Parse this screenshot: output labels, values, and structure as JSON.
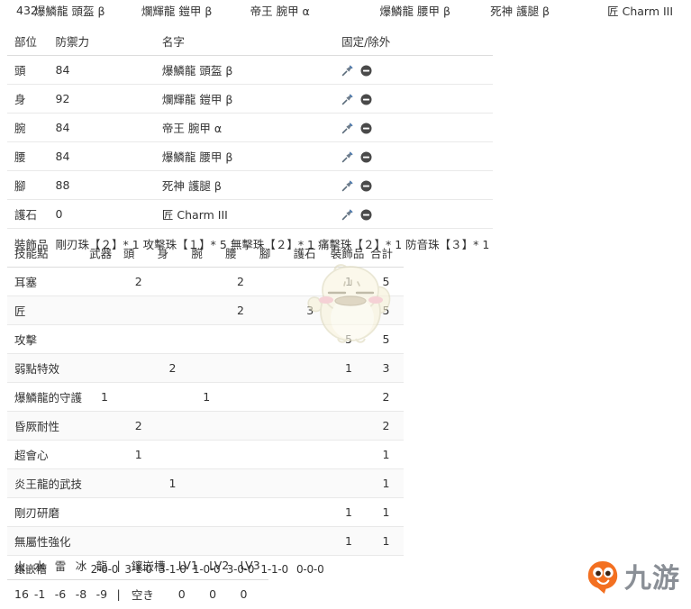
{
  "topbar": {
    "total_defense": "432",
    "pieces": [
      "爆鱗龍 頭盔 β",
      "爛輝龍 鎧甲 β",
      "帝王 腕甲 α",
      "爆鱗龍 腰甲 β",
      "死神 護腿 β",
      "匠 Charm III"
    ]
  },
  "equipment": {
    "headers": [
      "部位",
      "防禦力",
      "名字",
      "固定/除外"
    ],
    "rows": [
      {
        "part": "頭",
        "defense": "84",
        "name": "爆鱗龍 頭盔 β"
      },
      {
        "part": "身",
        "defense": "92",
        "name": "爛輝龍 鎧甲 β"
      },
      {
        "part": "腕",
        "defense": "84",
        "name": "帝王 腕甲 α"
      },
      {
        "part": "腰",
        "defense": "84",
        "name": "爆鱗龍 腰甲 β"
      },
      {
        "part": "腳",
        "defense": "88",
        "name": "死神 護腿 β"
      },
      {
        "part": "護石",
        "defense": "0",
        "name": "匠 Charm III"
      }
    ],
    "decoration_label": "裝飾品",
    "decoration_text": "剛刃珠【２】* 1 攻擊珠【１】* 5 無擊珠【２】* 1 痛擊珠【２】* 1 防音珠【３】* 1",
    "icons": {
      "pin": "pin-icon",
      "remove": "remove-icon"
    }
  },
  "skills": {
    "headers": [
      "技能點",
      "武器",
      "頭",
      "身",
      "腕",
      "腰",
      "腳",
      "護石",
      "裝飾品",
      "合計"
    ],
    "rows": [
      {
        "name": "耳塞",
        "values": [
          "",
          "2",
          "",
          "",
          "2",
          "",
          "",
          "1",
          "5"
        ]
      },
      {
        "name": "匠",
        "values": [
          "",
          "",
          "",
          "",
          "2",
          "",
          "3",
          "",
          "5"
        ]
      },
      {
        "name": "攻擊",
        "values": [
          "",
          "",
          "",
          "",
          "",
          "",
          "",
          "5",
          "5"
        ]
      },
      {
        "name": "弱點特效",
        "values": [
          "",
          "",
          "2",
          "",
          "",
          "",
          "",
          "1",
          "3"
        ]
      },
      {
        "name": "爆鱗龍的守護",
        "values": [
          "1",
          "",
          "",
          "1",
          "",
          "",
          "",
          "",
          "2"
        ]
      },
      {
        "name": "昏厥耐性",
        "values": [
          "",
          "2",
          "",
          "",
          "",
          "",
          "",
          "",
          "2"
        ]
      },
      {
        "name": "超會心",
        "values": [
          "",
          "1",
          "",
          "",
          "",
          "",
          "",
          "",
          "1"
        ]
      },
      {
        "name": "炎王龍的武技",
        "values": [
          "",
          "",
          "1",
          "",
          "",
          "",
          "",
          "",
          "1"
        ]
      },
      {
        "name": "剛刃研磨",
        "values": [
          "",
          "",
          "",
          "",
          "",
          "",
          "",
          "1",
          "1"
        ]
      },
      {
        "name": "無屬性強化",
        "values": [
          "",
          "",
          "",
          "",
          "",
          "",
          "",
          "1",
          "1"
        ]
      }
    ],
    "slots_label": "鑲嵌槽",
    "slots_values": [
      "2-0-0",
      "3-1-0",
      "3-1-0",
      "1-0-0",
      "3-0-0",
      "1-1-0",
      "0-0-0",
      "",
      ""
    ]
  },
  "resist": {
    "headers": [
      "火",
      "水",
      "雷",
      "冰",
      "龍",
      "|",
      "鑲嵌槽",
      "LV1",
      "LV2",
      "LV3"
    ],
    "values": [
      "16",
      "-1",
      "-6",
      "-8",
      "-9",
      "|",
      "空き",
      "0",
      "0",
      "0"
    ]
  },
  "brand": {
    "name": "九游",
    "logo_icon": "nine-game-mascot-icon"
  },
  "watermark": {
    "icon": "chick-mascot-watermark-icon"
  },
  "colors": {
    "link": "#4a7ebb",
    "text": "#333333",
    "border": "#dcdcdc",
    "brand_orange": "#f37021",
    "brand_gray": "#8a8f96"
  }
}
